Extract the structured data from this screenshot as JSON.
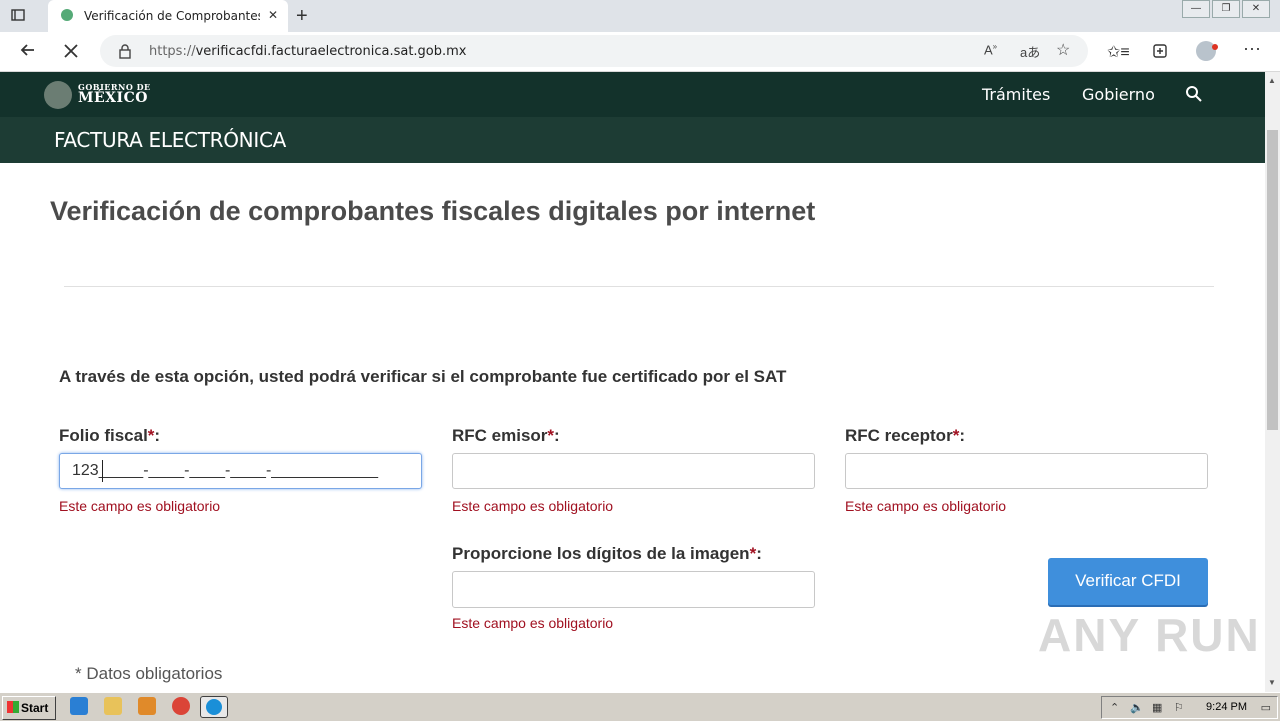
{
  "browser": {
    "tab_title": "Verificación de Comprobantes Fi",
    "tab_close": "✕",
    "new_tab": "+",
    "url_host": "https://verificacfdi.facturaelectronica.sat.gob.mx",
    "url_prefix": "https://",
    "url_domain": "verificacfdi.facturaelectronica.sat.gob.mx",
    "icons": [
      "window-icon",
      "back-icon",
      "stop-icon",
      "lock-icon",
      "read-aloud-icon",
      "translate-icon",
      "add-favorite-icon",
      "favorites-icon",
      "collections-icon",
      "profile-icon",
      "more-icon"
    ]
  },
  "header": {
    "gob_line1": "GOBIERNO DE",
    "gob_line2": "MÉXICO",
    "nav": [
      "Trámites",
      "Gobierno"
    ],
    "subtitle": "FACTURA ELECTRÓNICA"
  },
  "main": {
    "title": "Verificación de comprobantes fiscales digitales por internet",
    "intro": "A través de esta opción, usted podrá verificar si el comprobante fue certificado por el SAT",
    "fields": [
      {
        "label": "Folio fiscal",
        "star": "*",
        "colon": ":",
        "value": "123_____-____-____-____-____________",
        "error": "Este campo es obligatorio"
      },
      {
        "label": "RFC emisor",
        "star": "*",
        "colon": ":",
        "value": "",
        "error": "Este campo es obligatorio"
      },
      {
        "label": "RFC receptor",
        "star": "*",
        "colon": ":",
        "value": "",
        "error": "Este campo es obligatorio"
      },
      {
        "label": "Proporcione los dígitos de la imagen",
        "star": "*",
        "colon": ":",
        "value": "",
        "error": "Este campo es obligatorio"
      }
    ],
    "submit_label": "Verificar CFDI",
    "required_note": "* Datos obligatorios",
    "watermark": "ANY RUN"
  },
  "taskbar": {
    "start_label": "Start",
    "clock": "9:24 PM"
  },
  "colors": {
    "header_bg": "#13322b",
    "subheader_bg": "#1d3c34",
    "button": "#3f8fdc",
    "error": "#a01020"
  }
}
